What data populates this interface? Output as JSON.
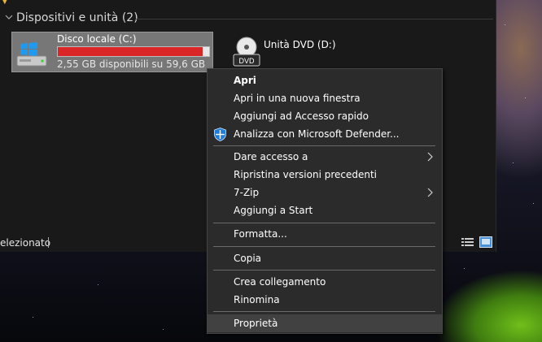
{
  "group": {
    "title": "Dispositivi e unità (2)"
  },
  "drives": [
    {
      "name": "Disco locale (C:)",
      "free_space": "2,55 GB disponibili su 59,6 GB",
      "used_fraction": 0.957,
      "bar_color": "#da2626",
      "icon": "windows-drive-icon"
    },
    {
      "name": "Unità DVD (D:)",
      "icon": "dvd-drive-icon",
      "icon_text": "DVD"
    }
  ],
  "statusbar": {
    "text": "elezionato"
  },
  "context_menu": {
    "items": [
      {
        "label": "Apri",
        "bold": true
      },
      {
        "label": "Apri in una nuova finestra"
      },
      {
        "label": "Aggiungi ad Accesso rapido"
      },
      {
        "label": "Analizza con Microsoft Defender...",
        "icon": "defender-shield-icon"
      },
      {
        "label": "Dare accesso a",
        "submenu": true
      },
      {
        "label": "Ripristina versioni precedenti"
      },
      {
        "label": "7-Zip",
        "submenu": true
      },
      {
        "label": "Aggiungi a Start"
      },
      {
        "label": "Formatta..."
      },
      {
        "label": "Copia"
      },
      {
        "label": "Crea collegamento"
      },
      {
        "label": "Rinomina"
      },
      {
        "label": "Proprietà",
        "highlighted": true
      }
    ]
  },
  "colors": {
    "window_bg": "#191919",
    "menu_bg": "#2b2b2b",
    "menu_hover": "#414141",
    "selection_bg": "#777777"
  }
}
